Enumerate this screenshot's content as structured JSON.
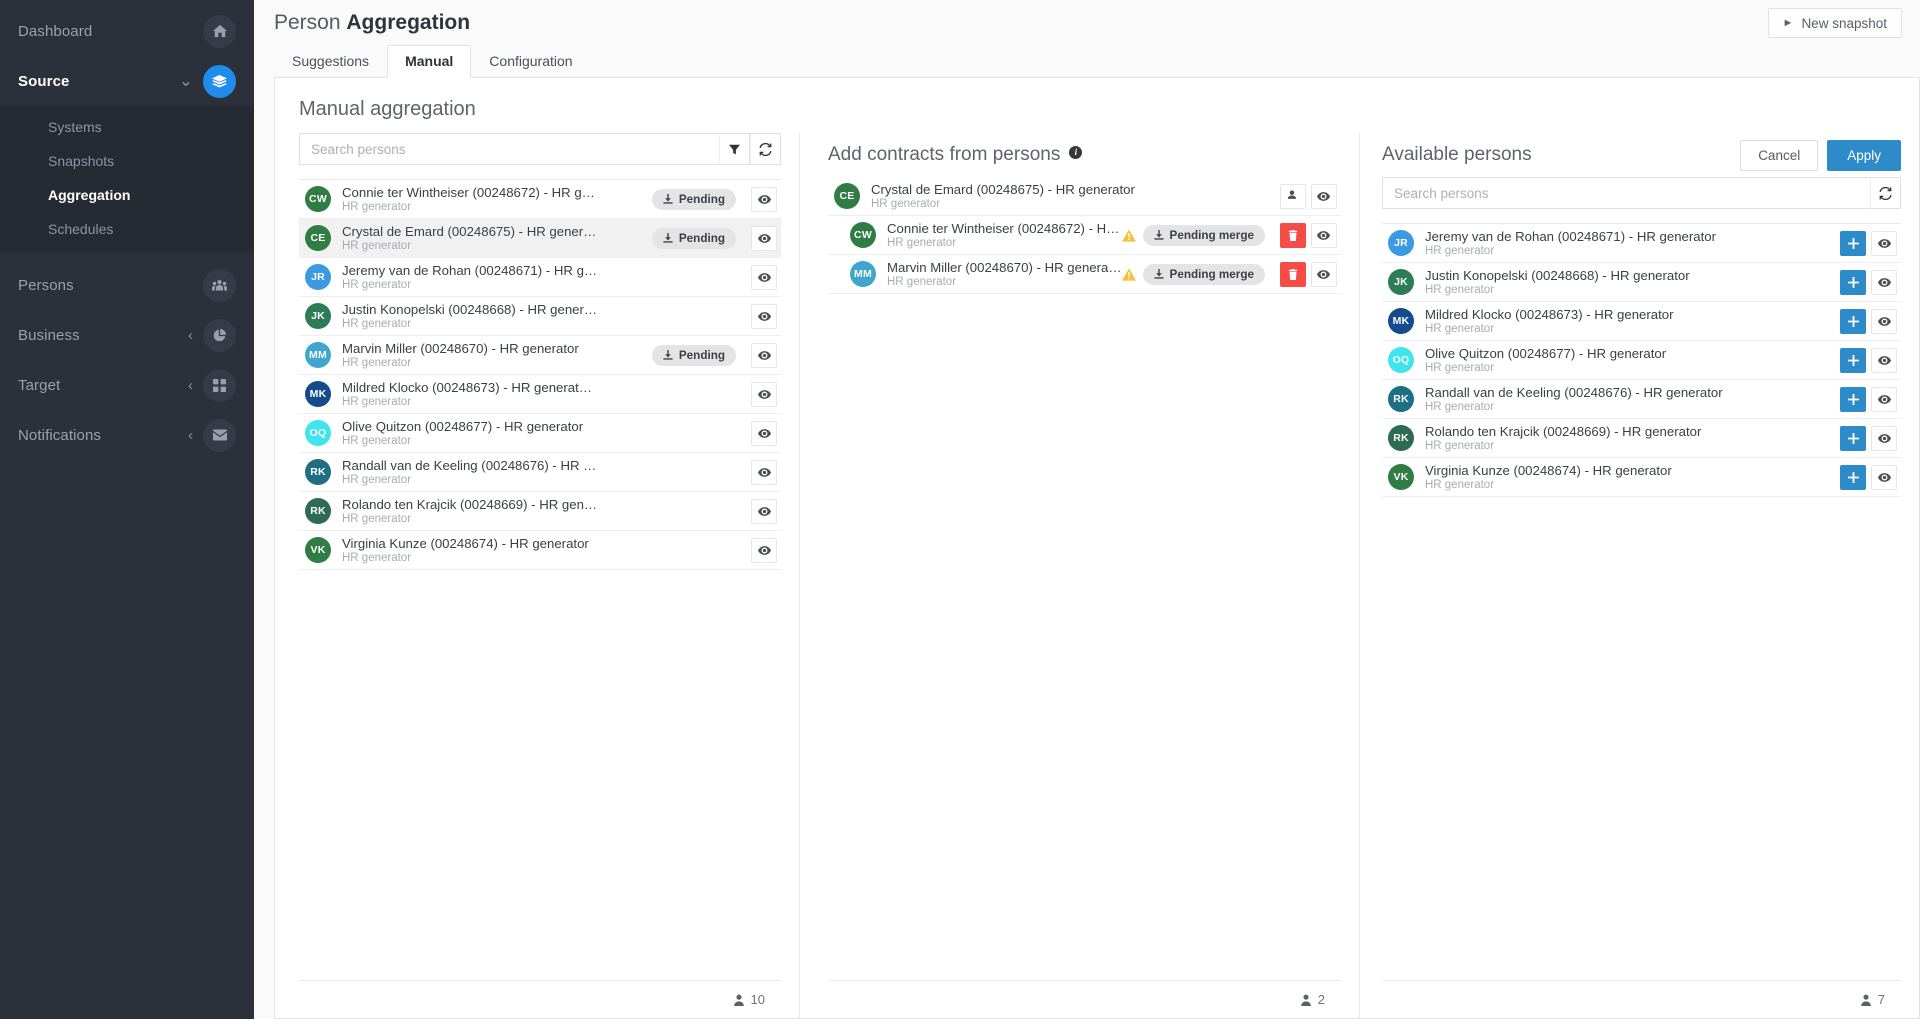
{
  "sidebar": {
    "items": [
      {
        "label": "Dashboard",
        "icon": "home-icon",
        "active": false,
        "chevron": false
      },
      {
        "label": "Source",
        "icon": "layers-icon",
        "active": true,
        "chevron": true
      },
      {
        "label": "Persons",
        "icon": "people-icon",
        "active": false,
        "chevron": false
      },
      {
        "label": "Business",
        "icon": "pie-chart-icon",
        "active": false,
        "chevron": true
      },
      {
        "label": "Target",
        "icon": "grid-icon",
        "active": false,
        "chevron": true
      },
      {
        "label": "Notifications",
        "icon": "envelope-icon",
        "active": false,
        "chevron": true
      }
    ],
    "submenu": [
      {
        "label": "Systems",
        "active": false
      },
      {
        "label": "Snapshots",
        "active": false
      },
      {
        "label": "Aggregation",
        "active": true
      },
      {
        "label": "Schedules",
        "active": false
      }
    ]
  },
  "header": {
    "title_prefix": "Person",
    "title_bold": "Aggregation",
    "new_snapshot_label": "New snapshot",
    "play_icon": "play-icon"
  },
  "tabs": [
    {
      "label": "Suggestions",
      "active": false
    },
    {
      "label": "Manual",
      "active": true
    },
    {
      "label": "Configuration",
      "active": false
    }
  ],
  "card": {
    "heading": "Manual aggregation"
  },
  "left_panel": {
    "search_placeholder": "Search persons",
    "search_value": "",
    "filter_icon": "filter-icon",
    "refresh_icon": "refresh-icon",
    "footer_count": "10",
    "footer_icon": "person-icon",
    "rows": [
      {
        "initials": "CW",
        "color": "#2f7d43",
        "title": "Connie ter Wintheiser (00248672) - HR g…",
        "sub": "HR generator",
        "badge": "Pending",
        "selected": false
      },
      {
        "initials": "CE",
        "color": "#2f7d43",
        "title": "Crystal de Emard (00248675) - HR gener…",
        "sub": "HR generator",
        "badge": "Pending",
        "selected": true
      },
      {
        "initials": "JR",
        "color": "#3b9ae1",
        "title": "Jeremy van de Rohan (00248671) - HR g…",
        "sub": "HR generator",
        "badge": "",
        "selected": false
      },
      {
        "initials": "JK",
        "color": "#2c7c58",
        "title": "Justin Konopelski (00248668) - HR gener…",
        "sub": "HR generator",
        "badge": "",
        "selected": false
      },
      {
        "initials": "MM",
        "color": "#40a6cd",
        "title": "Marvin Miller (00248670) - HR generator",
        "sub": "HR generator",
        "badge": "Pending",
        "selected": false
      },
      {
        "initials": "MK",
        "color": "#134b8c",
        "title": "Mildred Klocko (00248673) - HR generat…",
        "sub": "HR generator",
        "badge": "",
        "selected": false
      },
      {
        "initials": "OQ",
        "color": "#3fe5ee",
        "title": "Olive Quitzon (00248677) - HR generator",
        "sub": "HR generator",
        "badge": "",
        "selected": false
      },
      {
        "initials": "RK",
        "color": "#1e6e85",
        "title": "Randall van de Keeling (00248676) - HR …",
        "sub": "HR generator",
        "badge": "",
        "selected": false
      },
      {
        "initials": "RK",
        "color": "#2d6b52",
        "title": "Rolando ten Krajcik (00248669) - HR gen…",
        "sub": "HR generator",
        "badge": "",
        "selected": false
      },
      {
        "initials": "VK",
        "color": "#2f7d43",
        "title": "Virginia Kunze (00248674) - HR generator",
        "sub": "HR generator",
        "badge": "",
        "selected": false
      }
    ]
  },
  "mid_panel": {
    "title": "Add contracts from persons",
    "info_icon": "info-icon",
    "info_glyph": "i",
    "footer_count": "2",
    "footer_icon": "person-icon",
    "header_row": {
      "initials": "CE",
      "color": "#2f7d43",
      "title": "Crystal de Emard (00248675) - HR generator",
      "sub": "HR generator",
      "split_icon": "split-person-icon",
      "view_icon": "eye-icon"
    },
    "rows": [
      {
        "initials": "CW",
        "color": "#2f7d43",
        "title": "Connie ter Wintheiser (00248672) - H…",
        "sub": "HR generator",
        "badge": "Pending merge",
        "warn": true
      },
      {
        "initials": "MM",
        "color": "#40a6cd",
        "title": "Marvin Miller (00248670) - HR genera…",
        "sub": "HR generator",
        "badge": "Pending merge",
        "warn": true
      }
    ]
  },
  "right_panel": {
    "title": "Available persons",
    "cancel_label": "Cancel",
    "apply_label": "Apply",
    "search_placeholder": "Search persons",
    "search_value": "",
    "refresh_icon": "refresh-icon",
    "footer_count": "7",
    "footer_icon": "person-icon",
    "rows": [
      {
        "initials": "JR",
        "color": "#3b9ae1",
        "title": "Jeremy van de Rohan (00248671) - HR generator",
        "sub": "HR generator"
      },
      {
        "initials": "JK",
        "color": "#2c7c58",
        "title": "Justin Konopelski (00248668) - HR generator",
        "sub": "HR generator"
      },
      {
        "initials": "MK",
        "color": "#134b8c",
        "title": "Mildred Klocko (00248673) - HR generator",
        "sub": "HR generator"
      },
      {
        "initials": "OQ",
        "color": "#3fe5ee",
        "title": "Olive Quitzon (00248677) - HR generator",
        "sub": "HR generator"
      },
      {
        "initials": "RK",
        "color": "#1e6e85",
        "title": "Randall van de Keeling (00248676) - HR generator",
        "sub": "HR generator"
      },
      {
        "initials": "RK",
        "color": "#2d6b52",
        "title": "Rolando ten Krajcik (00248669) - HR generator",
        "sub": "HR generator"
      },
      {
        "initials": "VK",
        "color": "#2f7d43",
        "title": "Virginia Kunze (00248674) - HR generator",
        "sub": "HR generator"
      }
    ]
  },
  "colors": {
    "accent": "#2e8bc9",
    "sidebar_bg": "#2b303b",
    "submenu_bg": "#252a33",
    "danger": "#f64c46",
    "warning": "#f6c23b"
  }
}
